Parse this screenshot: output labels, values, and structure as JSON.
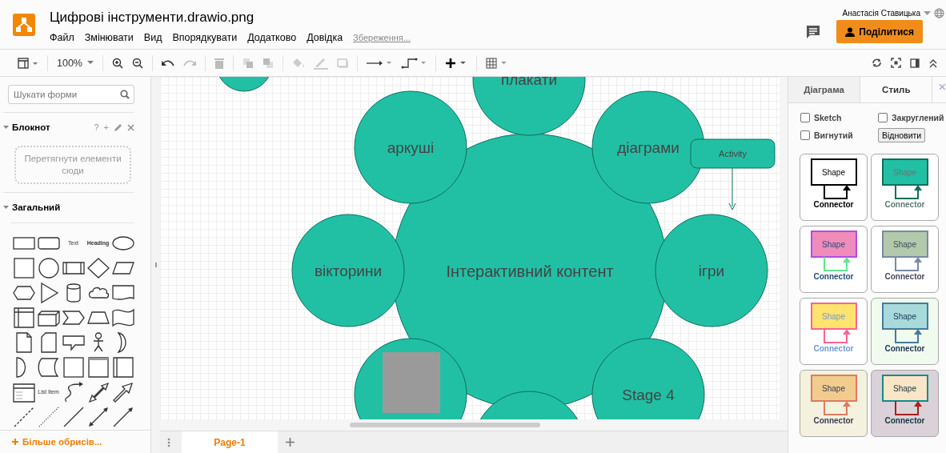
{
  "window": {
    "title": "Цифрові інструменти.drawio.png"
  },
  "menu": [
    "Файл",
    "Змінювати",
    "Вид",
    "Впорядкувати",
    "Додатково",
    "Довідка"
  ],
  "save_status": "Збереження...",
  "user": {
    "name": "Анастасія Ставицька"
  },
  "share_button": "Поділитися",
  "toolbar": {
    "zoom": "100%"
  },
  "shapes_panel": {
    "search": {
      "placeholder": "Шукати форми"
    },
    "sections": [
      {
        "title": "Блокнот",
        "expanded": true,
        "kind": "scratchpad",
        "hint": "Перетягнути елементи сюди",
        "actions": [
          "?",
          "+"
        ]
      },
      {
        "title": "Загальний",
        "expanded": true,
        "kind": "palette"
      }
    ],
    "palette": [
      {
        "kind": "rect"
      },
      {
        "kind": "rounded"
      },
      {
        "kind": "text",
        "label": "Text"
      },
      {
        "kind": "heading",
        "label": "Heading"
      },
      {
        "kind": "ellipse"
      },
      {
        "kind": "square"
      },
      {
        "kind": "circle"
      },
      {
        "kind": "process"
      },
      {
        "kind": "diamond"
      },
      {
        "kind": "parallelogram"
      },
      {
        "kind": "hexagon"
      },
      {
        "kind": "triangle"
      },
      {
        "kind": "cylinder"
      },
      {
        "kind": "cloud"
      },
      {
        "kind": "tape"
      },
      {
        "kind": "internal"
      },
      {
        "kind": "cube"
      },
      {
        "kind": "step"
      },
      {
        "kind": "trapezoid"
      },
      {
        "kind": "wave"
      },
      {
        "kind": "note"
      },
      {
        "kind": "card"
      },
      {
        "kind": "callout"
      },
      {
        "kind": "actor"
      },
      {
        "kind": "or"
      },
      {
        "kind": "and"
      },
      {
        "kind": "storage"
      },
      {
        "kind": "square"
      },
      {
        "kind": "frame"
      },
      {
        "kind": "split"
      },
      {
        "kind": "list"
      },
      {
        "kind": "listitem",
        "label": "List Item"
      },
      {
        "kind": "curve"
      },
      {
        "kind": "biarrow"
      },
      {
        "kind": "arrow"
      },
      {
        "kind": "dashed"
      },
      {
        "kind": "dotted"
      },
      {
        "kind": "line"
      },
      {
        "kind": "biline"
      },
      {
        "kind": "dirline"
      }
    ],
    "more_shapes": "Більше обрисів..."
  },
  "diagram": {
    "nodes": [
      {
        "kind": "circle"
      },
      {
        "kind": "circle",
        "label": "плакати"
      },
      {
        "kind": "circle",
        "label": "аркуші"
      },
      {
        "kind": "circle",
        "label": "діаграми"
      },
      {
        "kind": "box",
        "label": "Activity"
      },
      {
        "kind": "circle",
        "label": "вікторини"
      },
      {
        "kind": "hub",
        "label": "Інтерактивний контент"
      },
      {
        "kind": "circle",
        "label": "ігри"
      },
      {
        "kind": "photo"
      },
      {
        "kind": "circle",
        "label": "Stage 4"
      },
      {
        "kind": "circle"
      }
    ]
  },
  "pages": [
    {
      "label": "Page-1",
      "selected": true
    }
  ],
  "format_panel": {
    "tabs": [
      {
        "label": "Діаграма",
        "selected": false
      },
      {
        "label": "Стиль",
        "selected": true
      }
    ],
    "options": [
      {
        "label": "Sketch",
        "checked": false
      },
      {
        "label": "Закруглений",
        "checked": false
      },
      {
        "label": "Вигнутий",
        "checked": false
      }
    ],
    "reset_button": "Відновити",
    "styles": [
      {
        "background": {
          "color": "#ffffff"
        },
        "shape": {
          "label": "Shape",
          "color": "#ffffff"
        },
        "border": {
          "color": "#000000"
        },
        "connector": {
          "label": "Connector",
          "color": "#000000"
        },
        "text": {
          "color": "#000000"
        }
      },
      {
        "background": {
          "color": "#ffffff"
        },
        "shape": {
          "label": "Shape",
          "color": "#21c0a5"
        },
        "border": {
          "color": "#0e6e5c"
        },
        "connector": {
          "label": "Connector",
          "color": "#0e6e5c"
        },
        "text": {
          "color": "#5c7a72"
        }
      },
      {
        "background": {
          "color": "#ffffff"
        },
        "shape": {
          "label": "Shape",
          "color": "#f08cbb"
        },
        "border": {
          "color": "#b04ce6"
        },
        "connector": {
          "label": "Connector",
          "color": "#5fe68e"
        },
        "text": {
          "color": "#1e4f7a"
        }
      },
      {
        "background": {
          "color": "#ffffff"
        },
        "shape": {
          "label": "Shape",
          "color": "#b2c9ab"
        },
        "border": {
          "color": "#788aa3"
        },
        "connector": {
          "label": "Connector",
          "color": "#788aa3"
        },
        "text": {
          "color": "#46495d"
        }
      },
      {
        "background": {
          "color": "#ffffff"
        },
        "shape": {
          "label": "Shape",
          "color": "#fee36e"
        },
        "border": {
          "color": "#ff6392"
        },
        "connector": {
          "label": "Connector",
          "color": "#ff6392"
        },
        "text": {
          "color": "#6e98d6"
        }
      },
      {
        "background": {
          "color": "#f1faee"
        },
        "shape": {
          "label": "Shape",
          "color": "#a8dadc"
        },
        "border": {
          "color": "#457b9d"
        },
        "connector": {
          "label": "Connector",
          "color": "#457b9d"
        },
        "text": {
          "color": "#1d3557"
        }
      },
      {
        "background": {
          "color": "#f4f1de"
        },
        "shape": {
          "label": "Shape",
          "color": "#f2cc8f"
        },
        "border": {
          "color": "#e07a5f"
        },
        "connector": {
          "label": "Connector",
          "color": "#e07a5f"
        },
        "text": {
          "color": "#393c56"
        }
      },
      {
        "background": {
          "color": "#dad2d8"
        },
        "shape": {
          "label": "Shape",
          "color": "#fae5c7"
        },
        "border": {
          "color": "#0f8b8d"
        },
        "connector": {
          "label": "Connector",
          "color": "#a8201a"
        },
        "text": {
          "color": "#143642"
        }
      }
    ]
  }
}
